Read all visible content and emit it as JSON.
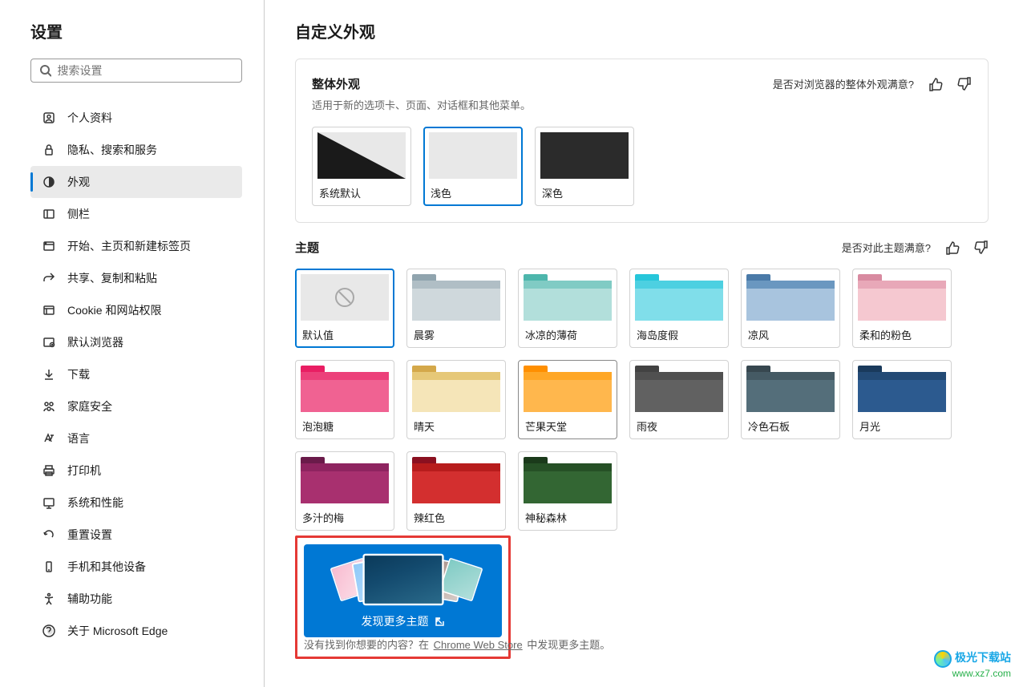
{
  "sidebar": {
    "title": "设置",
    "search_placeholder": "搜索设置",
    "items": [
      {
        "id": "profile",
        "label": "个人资料"
      },
      {
        "id": "privacy",
        "label": "隐私、搜索和服务"
      },
      {
        "id": "appearance",
        "label": "外观"
      },
      {
        "id": "sidebar",
        "label": "侧栏"
      },
      {
        "id": "start",
        "label": "开始、主页和新建标签页"
      },
      {
        "id": "share",
        "label": "共享、复制和粘贴"
      },
      {
        "id": "cookies",
        "label": "Cookie 和网站权限"
      },
      {
        "id": "default",
        "label": "默认浏览器"
      },
      {
        "id": "downloads",
        "label": "下载"
      },
      {
        "id": "family",
        "label": "家庭安全"
      },
      {
        "id": "languages",
        "label": "语言"
      },
      {
        "id": "printers",
        "label": "打印机"
      },
      {
        "id": "system",
        "label": "系统和性能"
      },
      {
        "id": "reset",
        "label": "重置设置"
      },
      {
        "id": "phone",
        "label": "手机和其他设备"
      },
      {
        "id": "accessibility",
        "label": "辅助功能"
      },
      {
        "id": "about",
        "label": "关于 Microsoft Edge"
      }
    ],
    "active": 2
  },
  "content": {
    "title": "自定义外观",
    "overall": {
      "title": "整体外观",
      "desc": "适用于新的选项卡、页面、对话框和其他菜单。",
      "rate_label": "是否对浏览器的整体外观满意?",
      "tiles": [
        {
          "id": "system",
          "label": "系统默认"
        },
        {
          "id": "light",
          "label": "浅色"
        },
        {
          "id": "dark",
          "label": "深色"
        }
      ],
      "selected": 1
    },
    "themes": {
      "title": "主题",
      "rate_label": "是否对此主题满意?",
      "tiles": [
        {
          "id": "default",
          "label": "默认值",
          "tab": "#d8d8d8",
          "bar": "#e5e5e5",
          "body": "#f1f1f1"
        },
        {
          "id": "mist",
          "label": "晨雾",
          "tab": "#90a4ae",
          "bar": "#b0bec5",
          "body": "#cfd8dc"
        },
        {
          "id": "mint",
          "label": "冰凉的薄荷",
          "tab": "#4db6ac",
          "bar": "#80cbc4",
          "body": "#b2dfdb"
        },
        {
          "id": "island",
          "label": "海岛度假",
          "tab": "#26c6da",
          "bar": "#4dd0e1",
          "body": "#80deea"
        },
        {
          "id": "breeze",
          "label": "凉风",
          "tab": "#4a7aa8",
          "bar": "#6a97c0",
          "body": "#a8c4de"
        },
        {
          "id": "softpink",
          "label": "柔和的粉色",
          "tab": "#d88aa0",
          "bar": "#e8a8b8",
          "body": "#f5c8d0"
        },
        {
          "id": "bubblegum",
          "label": "泡泡糖",
          "tab": "#e91e63",
          "bar": "#ec407a",
          "body": "#f06292"
        },
        {
          "id": "sunny",
          "label": "晴天",
          "tab": "#d4a84a",
          "bar": "#e6c878",
          "body": "#f5e5b8"
        },
        {
          "id": "mango",
          "label": "芒果天堂",
          "tab": "#ff8f00",
          "bar": "#ffa726",
          "body": "#ffb74d"
        },
        {
          "id": "rainy",
          "label": "雨夜",
          "tab": "#424242",
          "bar": "#505050",
          "body": "#616161"
        },
        {
          "id": "slate",
          "label": "冷色石板",
          "tab": "#37474f",
          "bar": "#455a64",
          "body": "#546e7a"
        },
        {
          "id": "moon",
          "label": "月光",
          "tab": "#1a3a5c",
          "bar": "#234a75",
          "body": "#2c5a8f"
        },
        {
          "id": "plum",
          "label": "多汁的梅",
          "tab": "#6a1b4a",
          "bar": "#8e2460",
          "body": "#a8306f"
        },
        {
          "id": "chili",
          "label": "辣红色",
          "tab": "#8a1020",
          "bar": "#b71c1c",
          "body": "#d32f2f"
        },
        {
          "id": "forest",
          "label": "神秘森林",
          "tab": "#1b3a1b",
          "bar": "#265026",
          "body": "#336633"
        }
      ],
      "selected": 0,
      "hover": 8,
      "discover_label": "发现更多主题",
      "footnote_prefix": "没有找到你想要的内容？在",
      "footnote_link": "Chrome Web Store",
      "footnote_suffix": "中发现更多主题。"
    }
  },
  "watermark": {
    "brand": "极光下载站",
    "url": "www.xz7.com"
  }
}
